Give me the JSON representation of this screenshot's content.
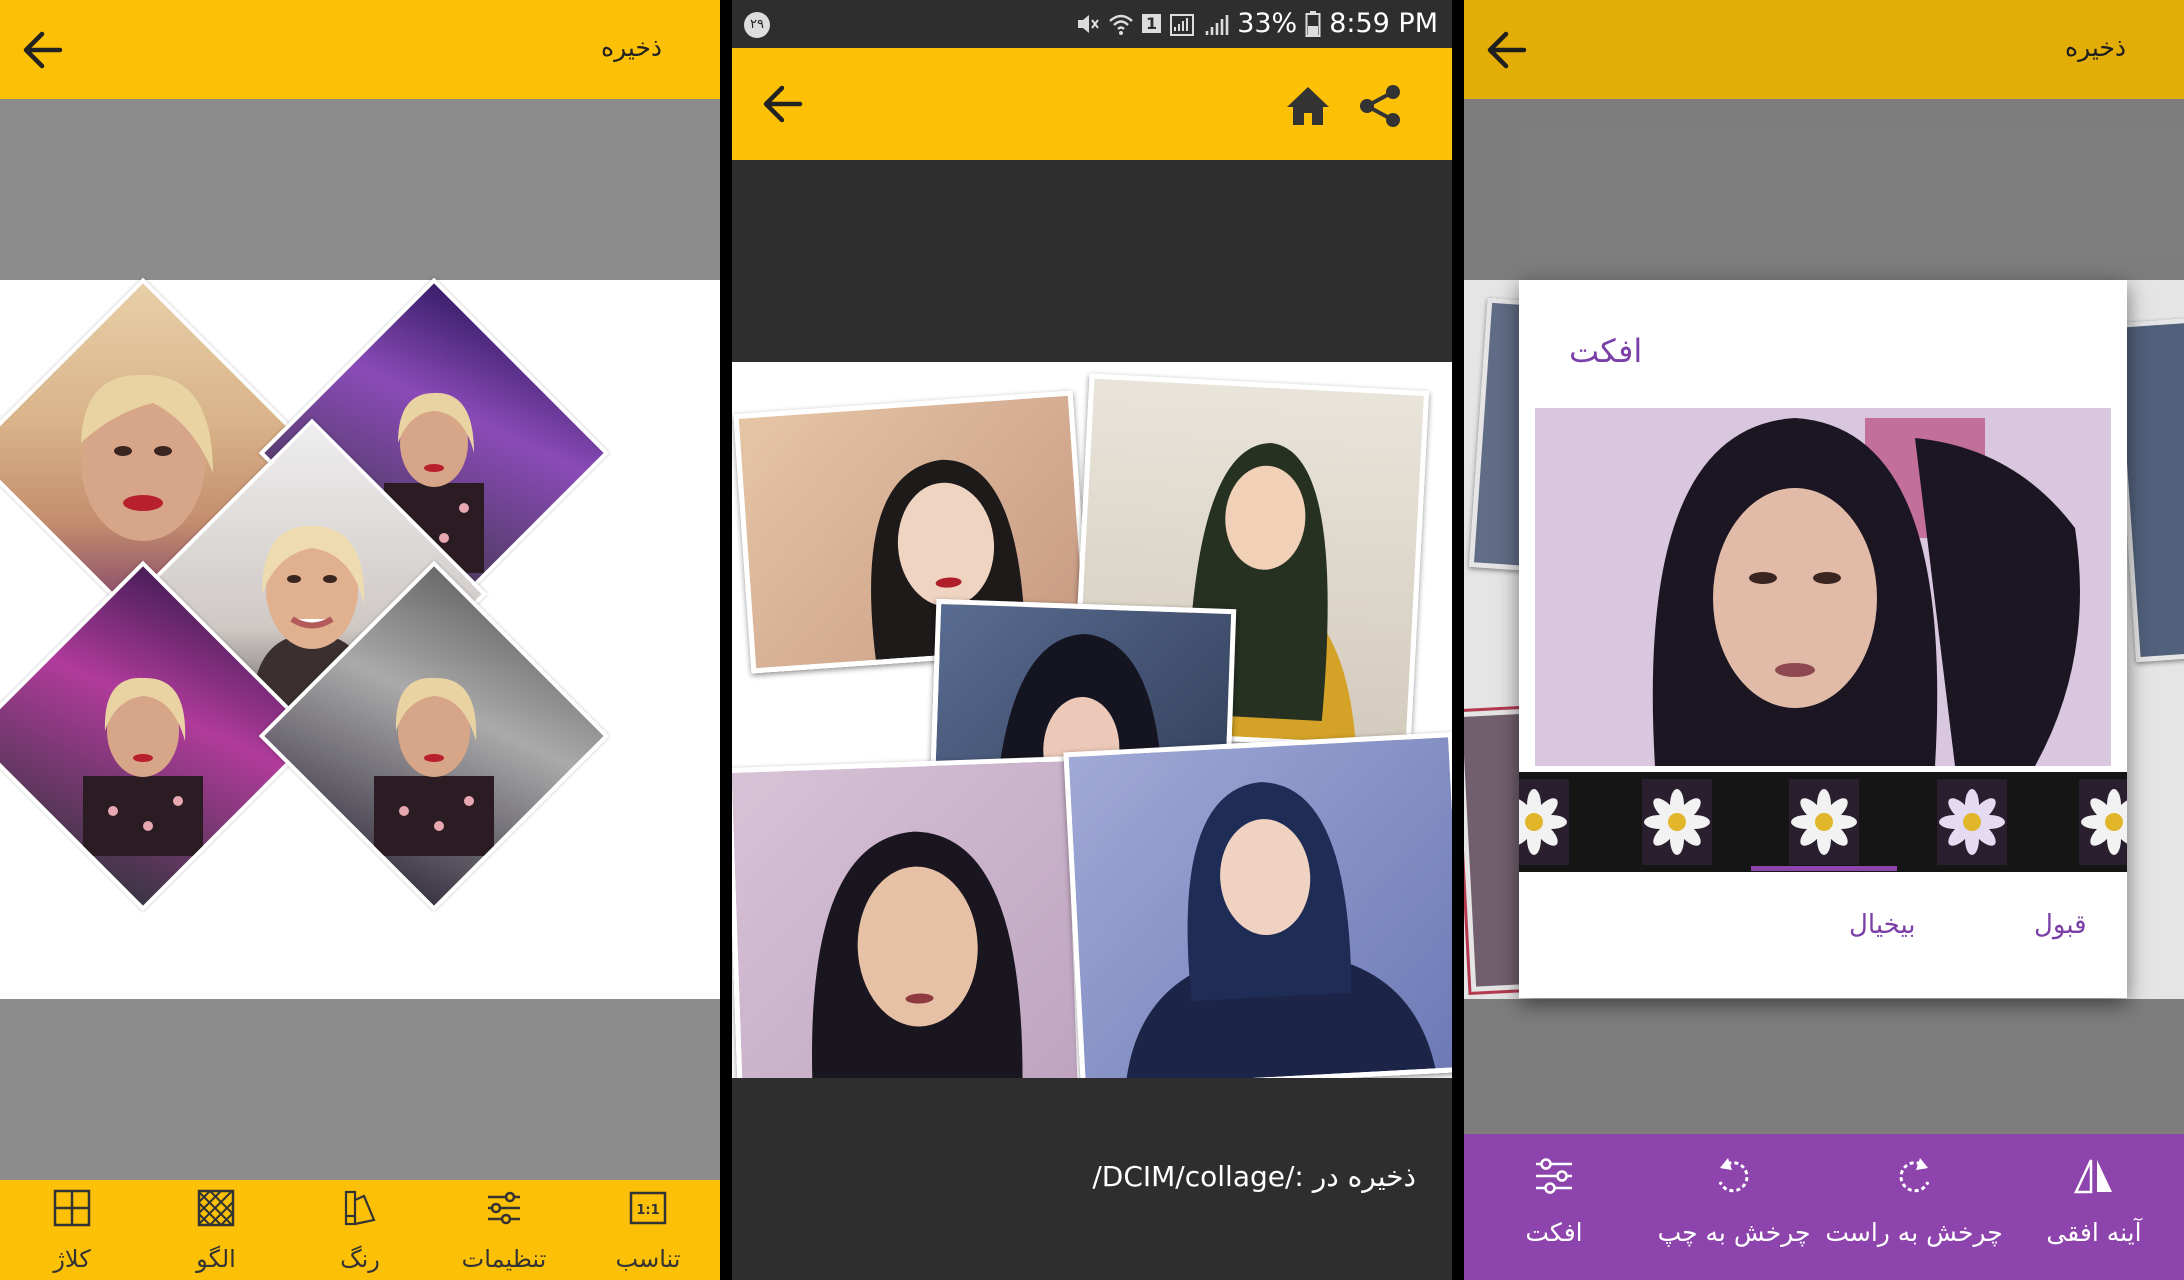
{
  "colors": {
    "accent_yellow": "#fcc107",
    "accent_purple": "#8e44ad",
    "dialog_text_purple": "#7b3fa8",
    "canvas_gray": "#8c8c8c",
    "dark_bg": "#2e2e2e"
  },
  "panel1": {
    "header": {
      "back_icon": "arrow-left-icon",
      "save_label": "ذخیره"
    },
    "toolbar": [
      {
        "label": "تناسب",
        "icon": "ratio-1-1-icon",
        "icon_text": "1:1"
      },
      {
        "label": "تنظیمات",
        "icon": "sliders-icon"
      },
      {
        "label": "رنگ",
        "icon": "palette-icon"
      },
      {
        "label": "الگو",
        "icon": "pattern-icon"
      },
      {
        "label": "کلاژ",
        "icon": "grid-layout-icon"
      }
    ]
  },
  "panel2": {
    "status": {
      "notification_count": "۲۹",
      "battery": "33%",
      "time": "8:59 PM",
      "sim": "1"
    },
    "header": {
      "back_icon": "arrow-left-icon",
      "home_icon": "home-icon",
      "share_icon": "share-icon"
    },
    "saved_path": "/DCIM/collage/: ذخیره در"
  },
  "panel3": {
    "header": {
      "back_icon": "arrow-left-icon",
      "save_label": "ذخیره"
    },
    "dialog": {
      "title": "افکت",
      "ok_label": "قبول",
      "cancel_label": "بیخیال",
      "selected_filter_index": 2
    },
    "toolbar": [
      {
        "label": "آینه افقی",
        "icon": "mirror-horizontal-icon"
      },
      {
        "label": "چرخش به راست",
        "icon": "rotate-right-icon"
      },
      {
        "label": "چرخش به چپ",
        "icon": "rotate-left-icon"
      },
      {
        "label": "افکت",
        "icon": "sliders-icon"
      }
    ]
  }
}
